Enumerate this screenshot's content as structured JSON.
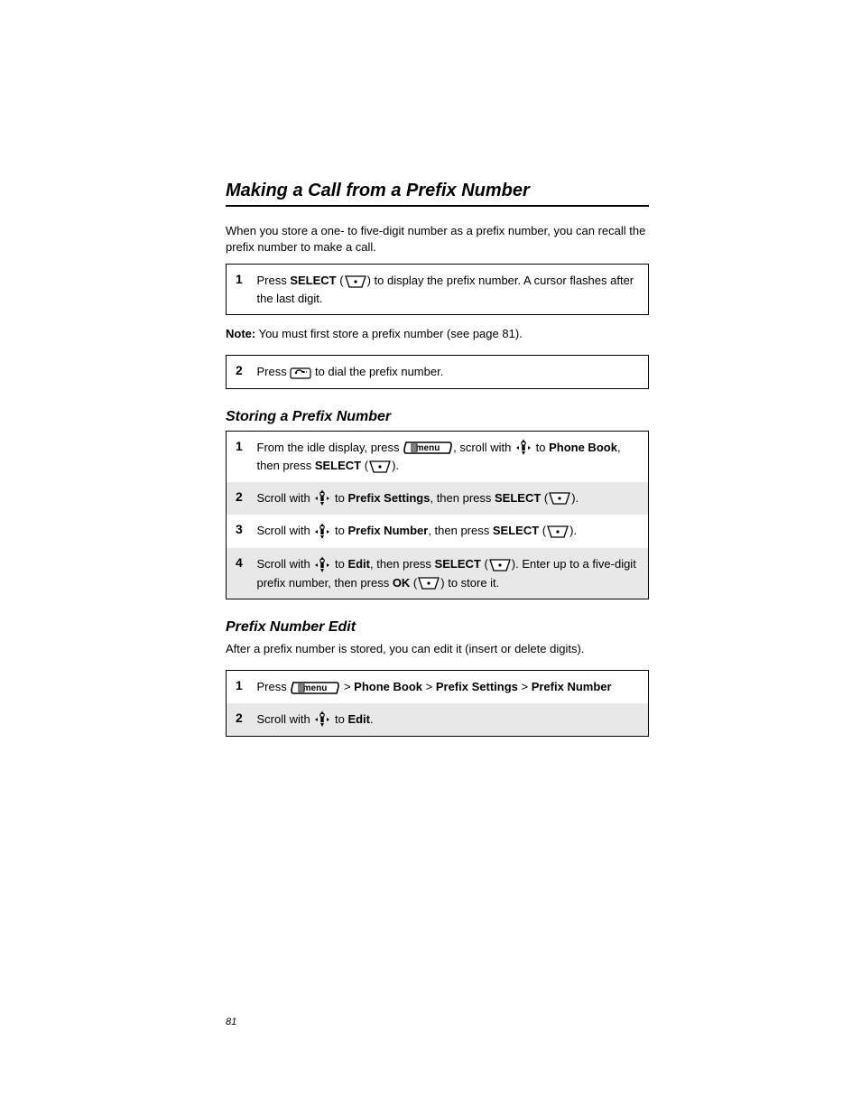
{
  "section1": {
    "heading": "Making a Call from a Prefix Number",
    "intro": "When you store a one- to five-digit number as a prefix number, you can recall the prefix number to make a call.",
    "steps": [
      {
        "num": "1",
        "parts": [
          "Press ",
          "SELECT",
          " (",
          ") to display the prefix number. A cursor flashes after the last digit."
        ]
      }
    ],
    "note_label": "Note:",
    "note_text": " You must first store a prefix number (see page 81).",
    "steps2": [
      {
        "num": "2",
        "parts": [
          "Press ",
          " to dial the prefix number."
        ]
      }
    ]
  },
  "section2": {
    "heading": "Storing a Prefix Number",
    "steps": [
      {
        "num": "1",
        "parts": [
          "From the idle display, press ",
          ", scroll with ",
          " to ",
          "Phone Book",
          ", then press ",
          "SELECT",
          " (",
          ")."
        ]
      },
      {
        "num": "2",
        "parts": [
          "Scroll with ",
          " to ",
          "Prefix Settings",
          ", then press ",
          "SELECT",
          " (",
          ")."
        ]
      },
      {
        "num": "3",
        "parts": [
          "Scroll with ",
          " to ",
          "Prefix Number",
          ", then press ",
          "SELECT",
          " (",
          ")."
        ]
      },
      {
        "num": "4",
        "parts": [
          "Scroll with ",
          " to ",
          "Edit",
          ", then press ",
          "SELECT",
          " (",
          "). Enter up to a five-digit prefix number, then press ",
          "OK",
          " (",
          ") to store it."
        ]
      }
    ]
  },
  "section3": {
    "heading": "Prefix Number Edit",
    "intro": "After a prefix number is stored, you can edit it (insert or delete digits).",
    "steps": [
      {
        "num": "1",
        "parts": [
          "Press ",
          " > ",
          "Phone Book",
          " > ",
          "Prefix Settings",
          " > ",
          "Prefix Number"
        ]
      },
      {
        "num": "2",
        "parts": [
          "Scroll with ",
          " to ",
          "Edit",
          "."
        ]
      }
    ]
  },
  "page_number": "81"
}
